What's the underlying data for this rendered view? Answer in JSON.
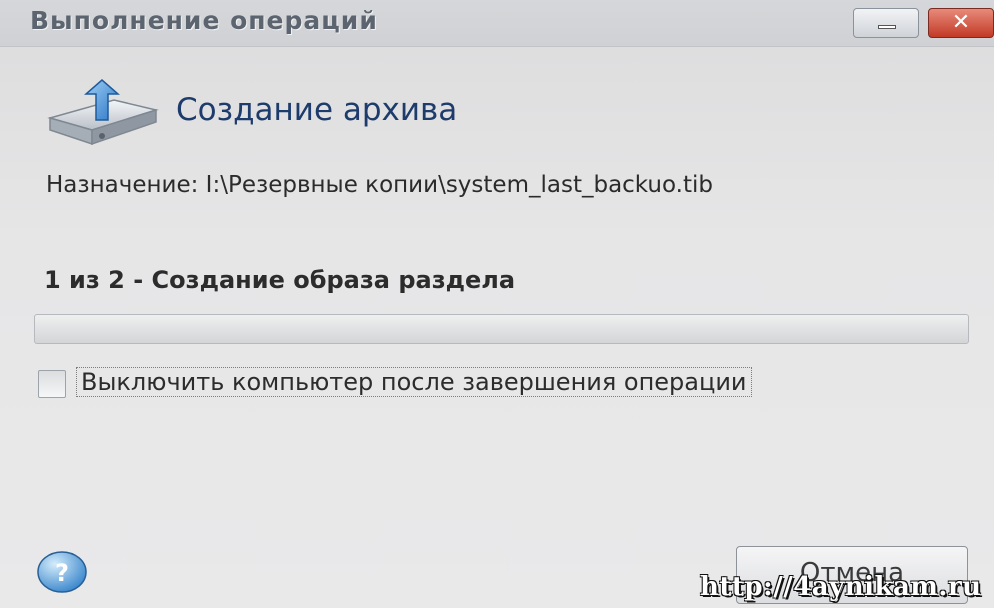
{
  "window": {
    "title": "Выполнение операций",
    "controls": {
      "minimize_icon": "minimize-icon",
      "close_label": "✕"
    }
  },
  "header": {
    "icon": "archive-drive-icon",
    "title": "Создание архива"
  },
  "destination": "Назначение: I:\\Резервные копии\\system_last_backuo.tib",
  "progress": {
    "step_text": "1 из 2 - Создание образа раздела",
    "fraction": 0.0
  },
  "shutdown_option": {
    "label": "Выключить компьютер после завершения операции",
    "checked": false
  },
  "footer": {
    "help_icon": "help-icon",
    "cancel_label": "Отмена"
  },
  "watermark": "http://4aynikam.ru"
}
